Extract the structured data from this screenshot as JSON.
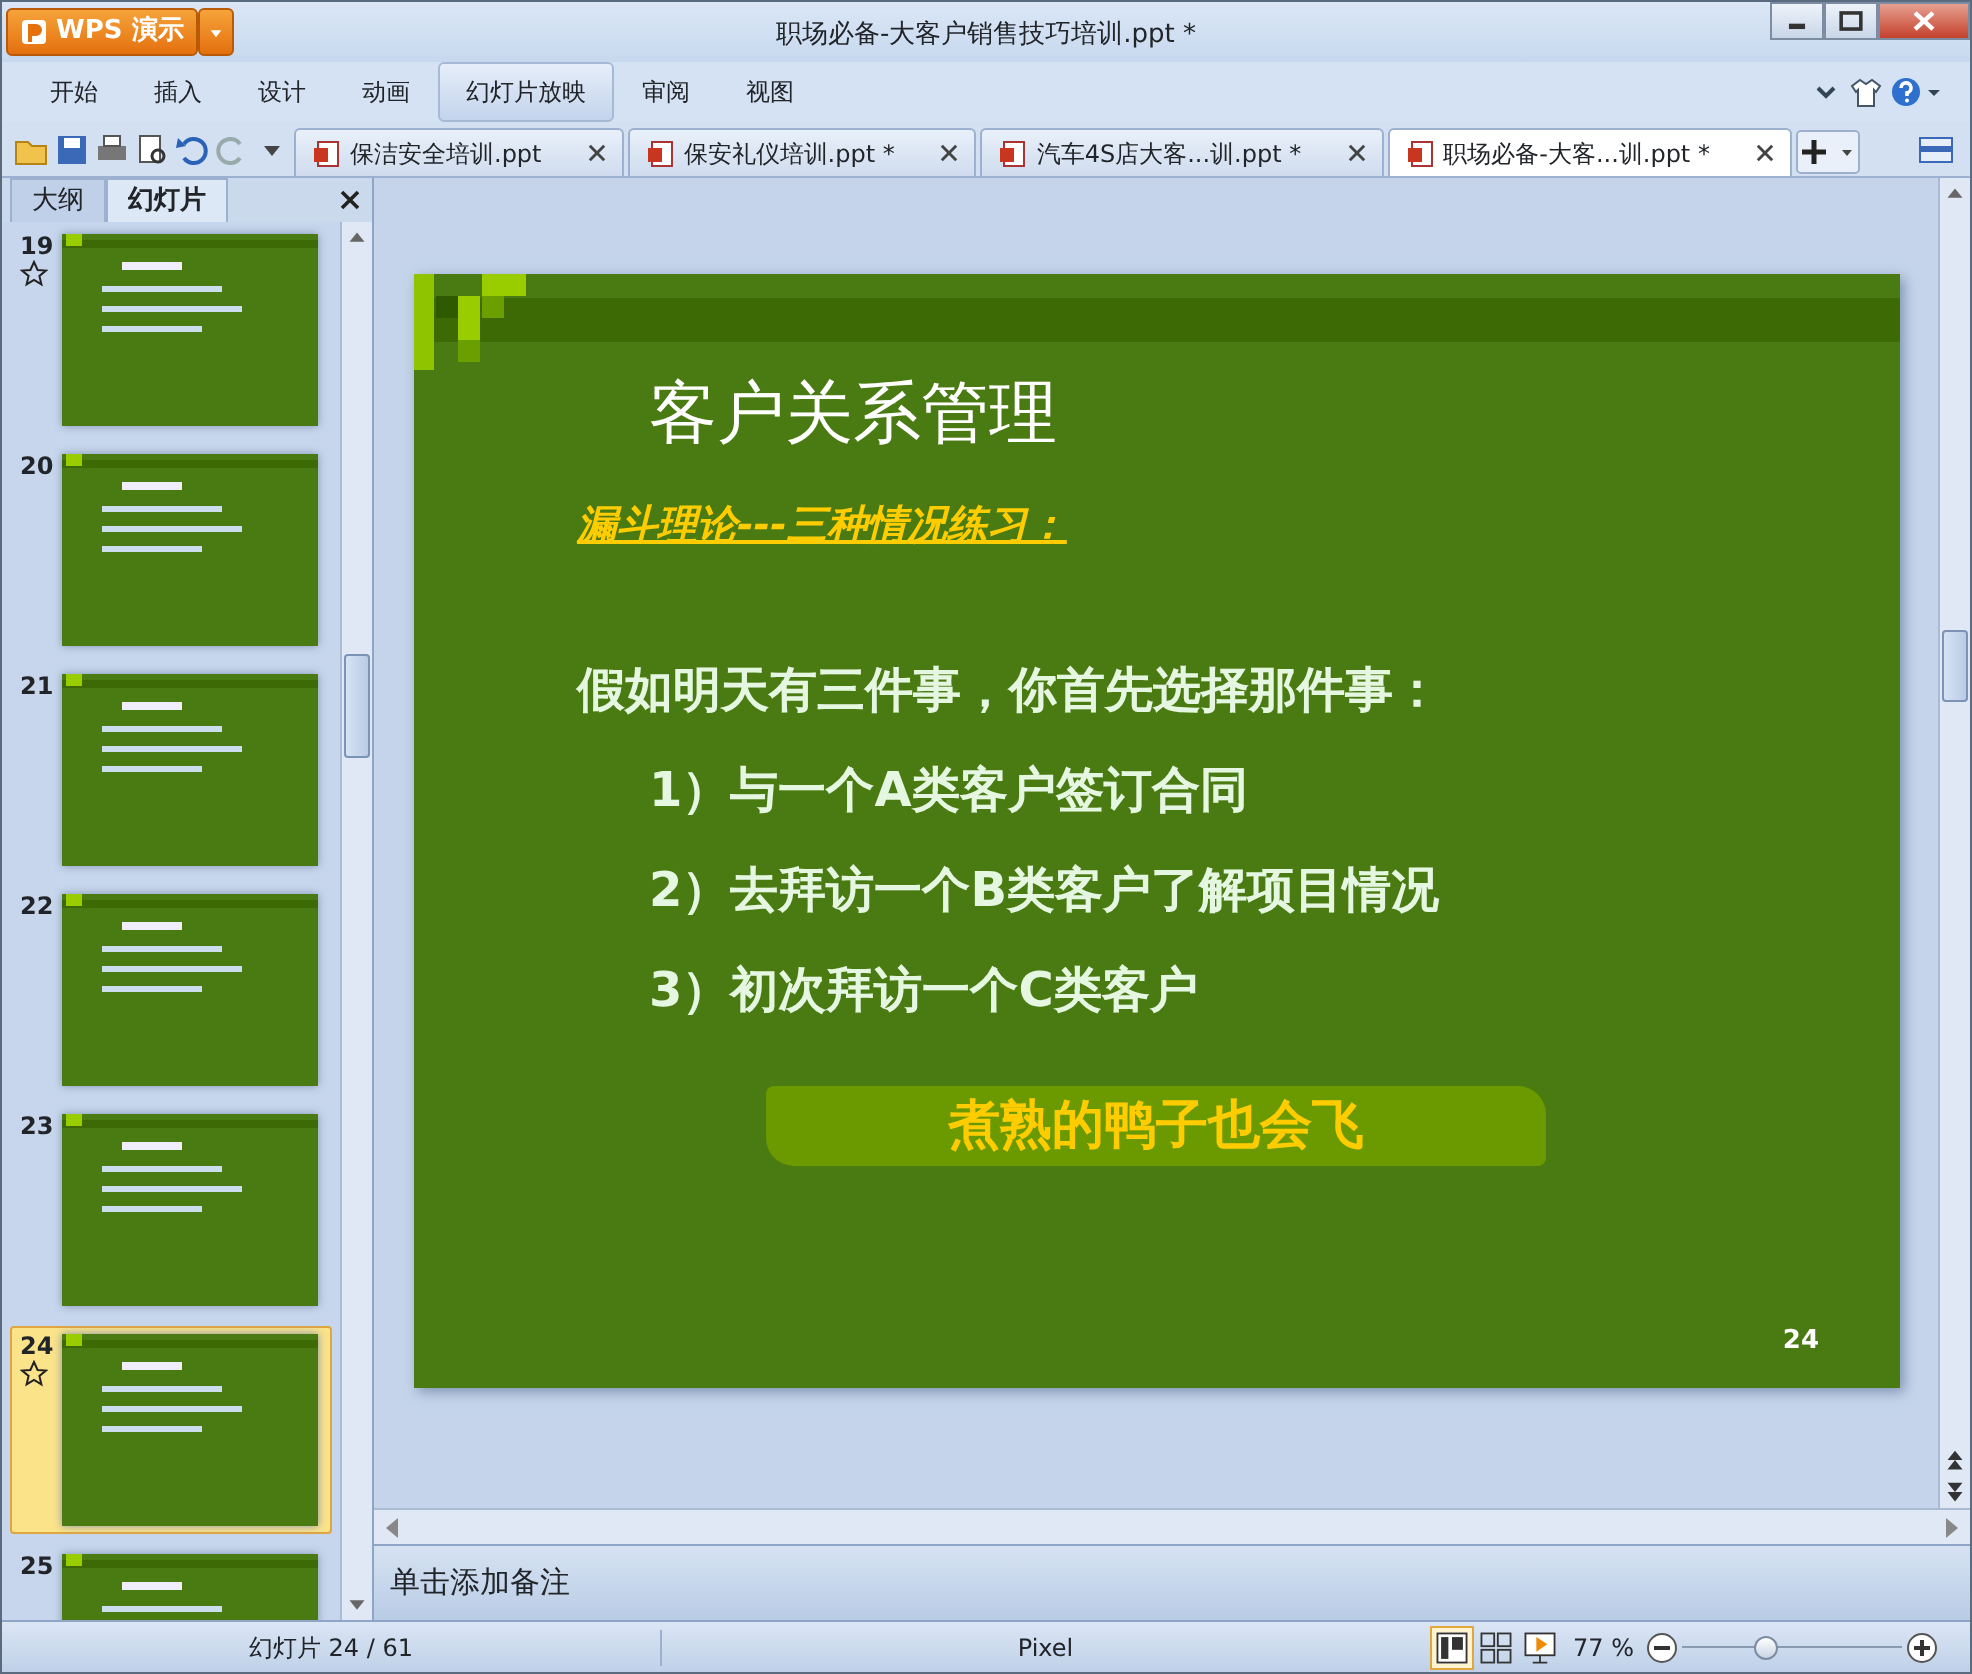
{
  "app_button": {
    "label": "WPS 演示"
  },
  "window": {
    "title": "职场必备-大客户销售技巧培训.ppt *"
  },
  "ribbon_tabs": [
    {
      "label": "开始",
      "highlighted": false
    },
    {
      "label": "插入",
      "highlighted": false
    },
    {
      "label": "设计",
      "highlighted": false
    },
    {
      "label": "动画",
      "highlighted": false
    },
    {
      "label": "幻灯片放映",
      "highlighted": true
    },
    {
      "label": "审阅",
      "highlighted": false
    },
    {
      "label": "视图",
      "highlighted": false
    }
  ],
  "doc_tabs": [
    {
      "label": "保洁安全培训.ppt",
      "selected": false
    },
    {
      "label": "保安礼仪培训.ppt *",
      "selected": false
    },
    {
      "label": "汽车4S店大客...训.ppt *",
      "selected": false
    },
    {
      "label": "职场必备-大客...训.ppt *",
      "selected": true
    }
  ],
  "panel_tabs": [
    {
      "label": "大纲",
      "selected": false
    },
    {
      "label": "幻灯片",
      "selected": true
    }
  ],
  "thumbnails": [
    {
      "number": "19",
      "starred": true,
      "selected": false
    },
    {
      "number": "20",
      "starred": false,
      "selected": false
    },
    {
      "number": "21",
      "starred": false,
      "selected": false
    },
    {
      "number": "22",
      "starred": false,
      "selected": false
    },
    {
      "number": "23",
      "starred": false,
      "selected": false
    },
    {
      "number": "24",
      "starred": true,
      "selected": true
    },
    {
      "number": "25",
      "starred": false,
      "selected": false
    }
  ],
  "slide": {
    "title": "客户关系管理",
    "subtitle": "漏斗理论---三种情况练习：",
    "question": "假如明天有三件事，你首先选择那件事：",
    "items": [
      "1）与一个A类客户签订合同",
      "2）去拜访一个B类客户了解项目情况",
      "3）初次拜访一个C类客户"
    ],
    "banner": "煮熟的鸭子也会飞",
    "page_number": "24"
  },
  "notes": {
    "placeholder": "单击添加备注"
  },
  "status_bar": {
    "slide_info": "幻灯片 24 / 61",
    "theme": "Pixel",
    "zoom": "77 %",
    "zoom_slider": {
      "level": 0.38
    }
  }
}
